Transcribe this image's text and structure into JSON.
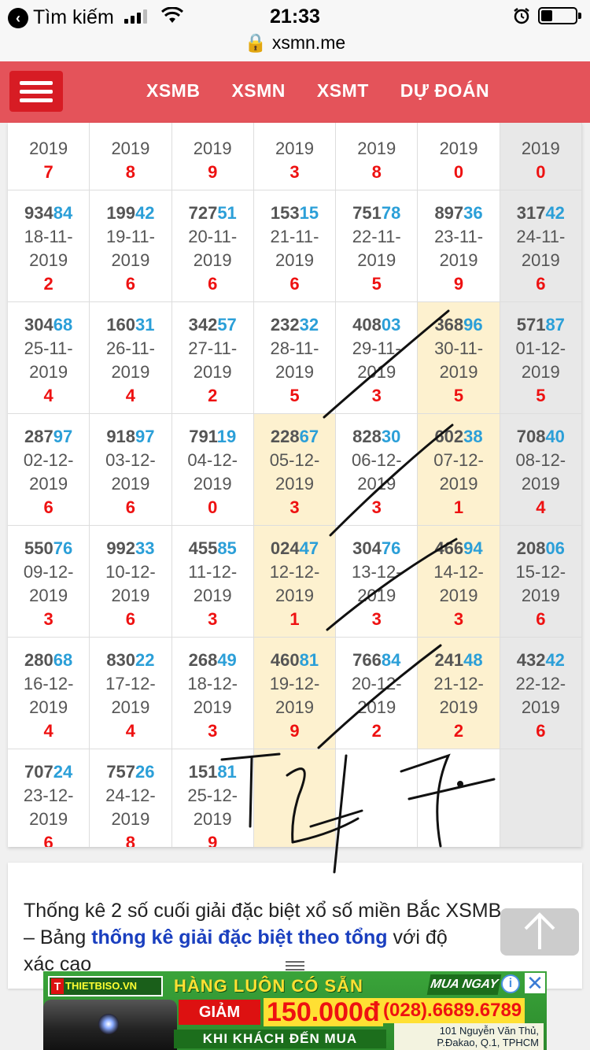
{
  "status_bar": {
    "back_label": "Tìm kiếm",
    "time": "21:33",
    "url": "xsmn.me"
  },
  "navbar": {
    "links": [
      "XSMB",
      "XSMN",
      "XSMT",
      "DỰ ĐOÁN"
    ]
  },
  "results": {
    "rows": [
      [
        {
          "prefix": "",
          "tail": "",
          "date": "2019",
          "sum": "7"
        },
        {
          "prefix": "",
          "tail": "",
          "date": "2019",
          "sum": "8"
        },
        {
          "prefix": "",
          "tail": "",
          "date": "2019",
          "sum": "9"
        },
        {
          "prefix": "",
          "tail": "",
          "date": "2019",
          "sum": "3"
        },
        {
          "prefix": "",
          "tail": "",
          "date": "2019",
          "sum": "8"
        },
        {
          "prefix": "",
          "tail": "",
          "date": "2019",
          "sum": "0"
        },
        {
          "prefix": "",
          "tail": "",
          "date": "2019",
          "sum": "0"
        }
      ],
      [
        {
          "prefix": "934",
          "tail": "84",
          "date": "18-11-",
          "year": "2019",
          "sum": "2"
        },
        {
          "prefix": "199",
          "tail": "42",
          "date": "19-11-",
          "year": "2019",
          "sum": "6"
        },
        {
          "prefix": "727",
          "tail": "51",
          "date": "20-11-",
          "year": "2019",
          "sum": "6"
        },
        {
          "prefix": "153",
          "tail": "15",
          "date": "21-11-",
          "year": "2019",
          "sum": "6"
        },
        {
          "prefix": "751",
          "tail": "78",
          "date": "22-11-",
          "year": "2019",
          "sum": "5"
        },
        {
          "prefix": "897",
          "tail": "36",
          "date": "23-11-",
          "year": "2019",
          "sum": "9"
        },
        {
          "prefix": "317",
          "tail": "42",
          "date": "24-11-",
          "year": "2019",
          "sum": "6"
        }
      ],
      [
        {
          "prefix": "304",
          "tail": "68",
          "date": "25-11-",
          "year": "2019",
          "sum": "4"
        },
        {
          "prefix": "160",
          "tail": "31",
          "date": "26-11-",
          "year": "2019",
          "sum": "4"
        },
        {
          "prefix": "342",
          "tail": "57",
          "date": "27-11-",
          "year": "2019",
          "sum": "2"
        },
        {
          "prefix": "232",
          "tail": "32",
          "date": "28-11-",
          "year": "2019",
          "sum": "5"
        },
        {
          "prefix": "408",
          "tail": "03",
          "date": "29-11-",
          "year": "2019",
          "sum": "3"
        },
        {
          "prefix": "368",
          "tail": "96",
          "date": "30-11-",
          "year": "2019",
          "sum": "5"
        },
        {
          "prefix": "571",
          "tail": "87",
          "date": "01-12-",
          "year": "2019",
          "sum": "5"
        }
      ],
      [
        {
          "prefix": "287",
          "tail": "97",
          "date": "02-12-",
          "year": "2019",
          "sum": "6"
        },
        {
          "prefix": "918",
          "tail": "97",
          "date": "03-12-",
          "year": "2019",
          "sum": "6"
        },
        {
          "prefix": "791",
          "tail": "19",
          "date": "04-12-",
          "year": "2019",
          "sum": "0"
        },
        {
          "prefix": "228",
          "tail": "67",
          "date": "05-12-",
          "year": "2019",
          "sum": "3"
        },
        {
          "prefix": "828",
          "tail": "30",
          "date": "06-12-",
          "year": "2019",
          "sum": "3"
        },
        {
          "prefix": "602",
          "tail": "38",
          "date": "07-12-",
          "year": "2019",
          "sum": "1"
        },
        {
          "prefix": "708",
          "tail": "40",
          "date": "08-12-",
          "year": "2019",
          "sum": "4"
        }
      ],
      [
        {
          "prefix": "550",
          "tail": "76",
          "date": "09-12-",
          "year": "2019",
          "sum": "3"
        },
        {
          "prefix": "992",
          "tail": "33",
          "date": "10-12-",
          "year": "2019",
          "sum": "6"
        },
        {
          "prefix": "455",
          "tail": "85",
          "date": "11-12-",
          "year": "2019",
          "sum": "3"
        },
        {
          "prefix": "024",
          "tail": "47",
          "date": "12-12-",
          "year": "2019",
          "sum": "1"
        },
        {
          "prefix": "304",
          "tail": "76",
          "date": "13-12-",
          "year": "2019",
          "sum": "3"
        },
        {
          "prefix": "466",
          "tail": "94",
          "date": "14-12-",
          "year": "2019",
          "sum": "3"
        },
        {
          "prefix": "208",
          "tail": "06",
          "date": "15-12-",
          "year": "2019",
          "sum": "6"
        }
      ],
      [
        {
          "prefix": "280",
          "tail": "68",
          "date": "16-12-",
          "year": "2019",
          "sum": "4"
        },
        {
          "prefix": "830",
          "tail": "22",
          "date": "17-12-",
          "year": "2019",
          "sum": "4"
        },
        {
          "prefix": "268",
          "tail": "49",
          "date": "18-12-",
          "year": "2019",
          "sum": "3"
        },
        {
          "prefix": "460",
          "tail": "81",
          "date": "19-12-",
          "year": "2019",
          "sum": "9"
        },
        {
          "prefix": "766",
          "tail": "84",
          "date": "20-12-",
          "year": "2019",
          "sum": "2"
        },
        {
          "prefix": "241",
          "tail": "48",
          "date": "21-12-",
          "year": "2019",
          "sum": "2"
        },
        {
          "prefix": "432",
          "tail": "42",
          "date": "22-12-",
          "year": "2019",
          "sum": "6"
        }
      ],
      [
        {
          "prefix": "707",
          "tail": "24",
          "date": "23-12-",
          "year": "2019",
          "sum": "6"
        },
        {
          "prefix": "757",
          "tail": "26",
          "date": "24-12-",
          "year": "2019",
          "sum": "8"
        },
        {
          "prefix": "151",
          "tail": "81",
          "date": "25-12-",
          "year": "2019",
          "sum": "9"
        },
        {
          "prefix": "",
          "tail": "",
          "date": "",
          "year": "",
          "sum": ""
        },
        {
          "prefix": "",
          "tail": "",
          "date": "",
          "year": "",
          "sum": ""
        },
        {
          "prefix": "",
          "tail": "",
          "date": "",
          "year": "",
          "sum": ""
        },
        {
          "prefix": "",
          "tail": "",
          "date": "",
          "year": "",
          "sum": ""
        }
      ]
    ],
    "highlight_column": 5,
    "colors": {
      "tail": "#2b9fd8",
      "sum": "#e11111",
      "highlight": "#fdf1cf",
      "sunday": "#e8e8e8"
    }
  },
  "stat": {
    "line1": "Thống kê 2 số cuối giải đặc biệt xổ số miền Bắc XSMB",
    "line2_prefix": "– Bảng ",
    "line2_link": "thống kê giải đặc biệt theo tổng",
    "line2_suffix": " với độ",
    "line3": "xác cao"
  },
  "ad": {
    "logo": "THIETBISO.VN",
    "headline": "HÀNG LUÔN CÓ SẴN",
    "buy_now": "MUA NGAY",
    "discount_label": "GIẢM",
    "price": "150.000đ",
    "phone": "(028).6689.6789",
    "bottom": "KHI KHÁCH ĐẾN MUA",
    "address": "101 Nguyễn Văn Thủ, P.Đakao, Q.1, TPHCM"
  },
  "handwriting": "T247"
}
